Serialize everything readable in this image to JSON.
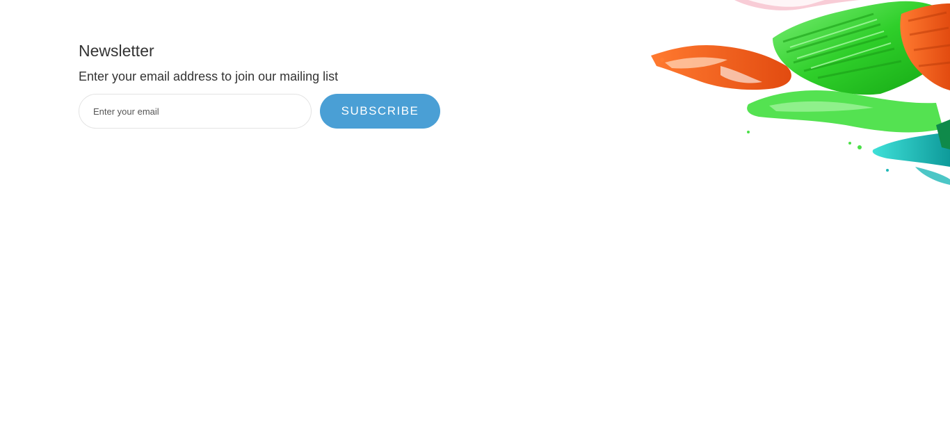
{
  "newsletter": {
    "title": "Newsletter",
    "subtitle": "Enter your email address to join our mailing list",
    "email_placeholder": "Enter your email",
    "email_value": "",
    "subscribe_label": "SUBSCRIBE"
  },
  "colors": {
    "accent": "#4a9fd5",
    "text": "#333333",
    "paint_green": "#3fd83a",
    "paint_orange": "#f26a1f",
    "paint_teal": "#1fb8b8",
    "paint_pink": "#f4b8c8"
  },
  "decor": {
    "icon": "paint-brushes-image"
  }
}
